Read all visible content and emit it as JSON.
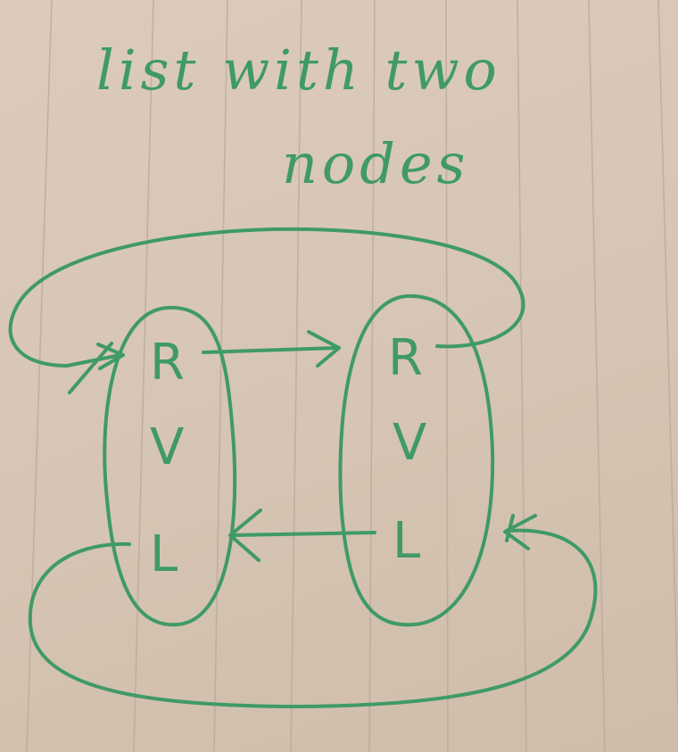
{
  "title": {
    "line1": "list with two",
    "line2": "nodes"
  },
  "nodes": [
    {
      "id": "node-1",
      "fields": [
        "R",
        "V",
        "L"
      ]
    },
    {
      "id": "node-2",
      "fields": [
        "R",
        "V",
        "L"
      ]
    }
  ],
  "colors": {
    "ink": "#3f9a66",
    "paper": "#d9c8b9",
    "rules": "#b7a99b"
  }
}
